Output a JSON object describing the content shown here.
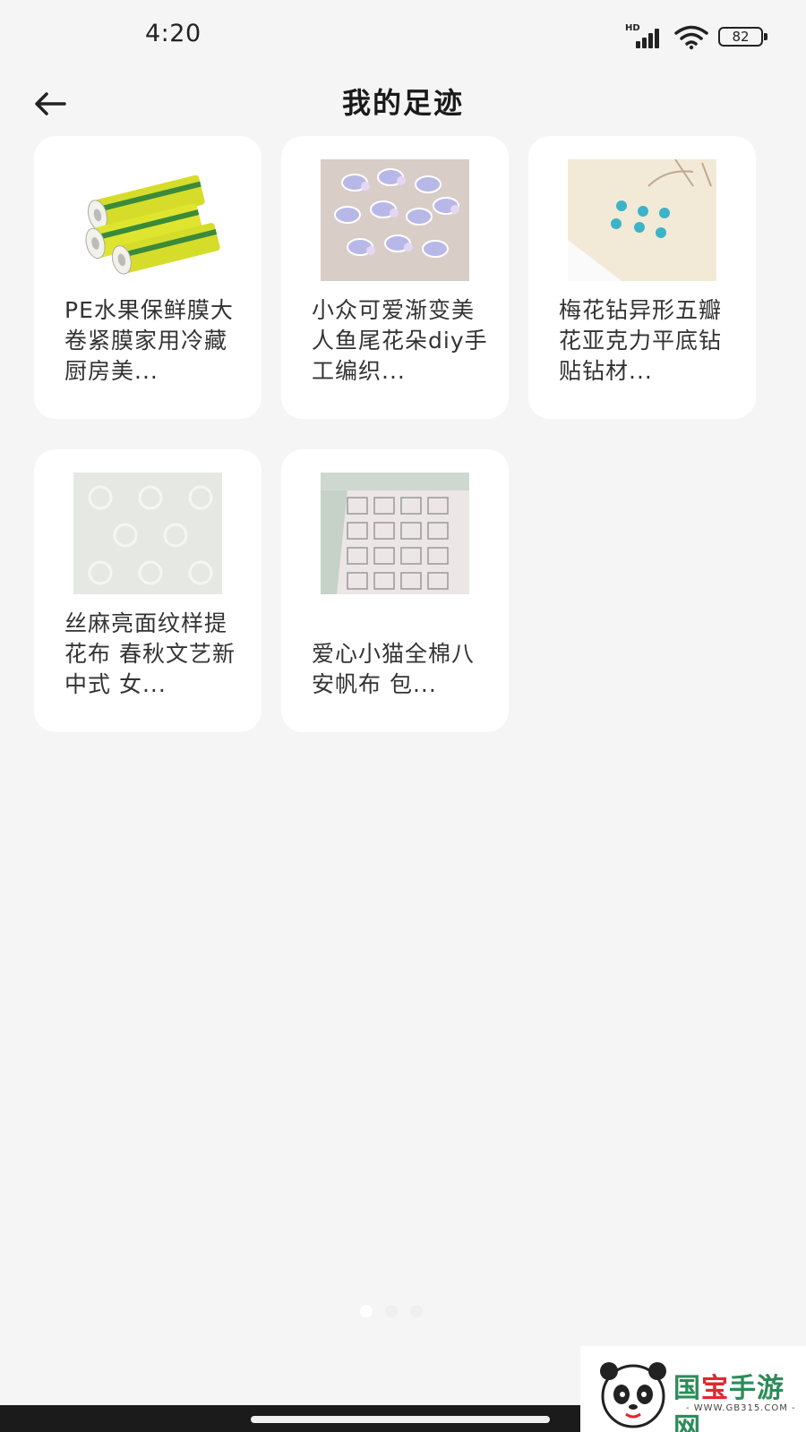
{
  "status_bar": {
    "time": "4:20",
    "network_label": "HD",
    "battery": "82"
  },
  "header": {
    "title": "我的足迹",
    "back_icon": "arrow-left-icon"
  },
  "products": [
    {
      "title": "PE水果保鲜膜大卷紧膜家用冷藏厨房美...",
      "image": "cling-film-rolls"
    },
    {
      "title": "小众可爱渐变美人鱼尾花朵diy手工编织...",
      "image": "mermaid-tail-flowers"
    },
    {
      "title": "梅花钻异形五瓣花亚克力平底钻贴钻材...",
      "image": "blue-flower-rhinestones"
    },
    {
      "title": "丝麻亮面纹样提花布 春秋文艺新中式 女...",
      "image": "jacquard-fabric"
    },
    {
      "title": "爱心小猫全棉八安帆布 包...",
      "image": "cat-print-canvas"
    }
  ],
  "pager": {
    "count": 3,
    "active": 0
  },
  "watermark": {
    "brand_part1": "国",
    "brand_part2": "宝",
    "brand_part3": "手游网",
    "url": "- WWW.GB315.COM -"
  }
}
